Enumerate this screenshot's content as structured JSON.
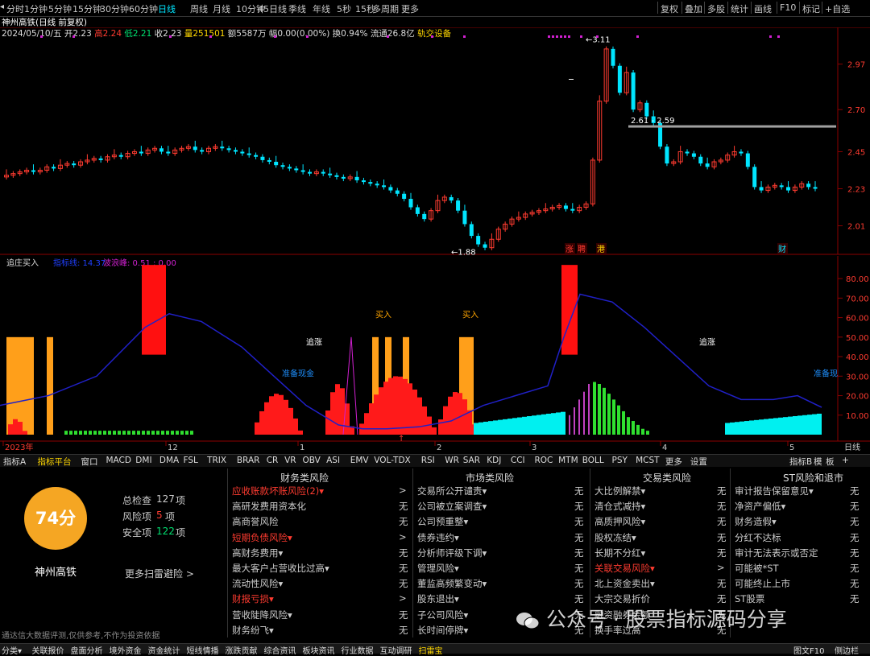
{
  "periods": [
    "分时",
    "1分钟",
    "5分钟",
    "15分钟",
    "30分钟",
    "60分钟",
    "日线",
    "周线",
    "月线",
    "10分钟",
    "45日线",
    "季线",
    "年线",
    "5秒",
    "15秒",
    "多周期",
    "更多"
  ],
  "active_period": "日线",
  "right_tools": [
    "复权",
    "叠加",
    "多股",
    "统计",
    "画线",
    "F10",
    "标记",
    "+自选"
  ],
  "stock_title": "神州高铁(日线 前复权)",
  "info": {
    "date": "2024/05/10/五",
    "open_label": "开",
    "open": "2.23",
    "high_label": "高",
    "high": "2.24",
    "low_label": "低",
    "low": "2.21",
    "close_label": "收",
    "close": "2.23",
    "vol_label": "量",
    "vol": "251501",
    "amount_label": "额",
    "amount": "5587万",
    "change_label": "幅",
    "change": "0.00(0.00%)",
    "turnover_label": "换",
    "turnover": "0.94%",
    "float_label": "流通",
    "float": "26.8亿",
    "sector": "轨交设备"
  },
  "price_axis": [
    "2.97",
    "2.70",
    "2.45",
    "2.23",
    "2.01"
  ],
  "annotations": {
    "high_price": "3.11",
    "low_price": "1.88",
    "resistance": "2.61 - 2.59"
  },
  "event_tags": [
    "涨",
    "聘",
    "港",
    "财"
  ],
  "indicator": {
    "name": "追庄买入",
    "line1_label": "指标线",
    "line1_value": "14.37",
    "line2_label": "波浪峰",
    "line2_value": "0.51",
    "line3_value": "0.00",
    "axis": [
      "80.00",
      "70.00",
      "60.00",
      "50.00",
      "40.00",
      "30.00",
      "20.00",
      "10.00"
    ],
    "labels": {
      "chase": "追涨",
      "buy": "买入",
      "prepare": "准备现金",
      "prepare_short": "准备现",
      "mid_buy": "买入"
    }
  },
  "time_axis": [
    "2023年",
    "12",
    "1",
    "2",
    "3",
    "4",
    "5"
  ],
  "time_axis_right": "日线",
  "indicator_tabs": [
    "指标A",
    "指标平台",
    "窗口",
    "MACD",
    "DMI",
    "DMA",
    "FSL",
    "TRIX",
    "BRAR",
    "CR",
    "VR",
    "OBV",
    "ASI",
    "EMV",
    "VOL-TDX",
    "RSI",
    "WR",
    "SAR",
    "KDJ",
    "CCI",
    "ROC",
    "MTM",
    "BOLL",
    "PSY",
    "MCST",
    "更多",
    "设置"
  ],
  "indicator_tabs_right": [
    "指标B",
    "模",
    "板",
    "+"
  ],
  "risk": {
    "score": "74分",
    "stock_name": "神州高铁",
    "total_label": "总检查",
    "total": "127",
    "total_unit": "项",
    "risk_label": "风险项",
    "risk_count": "5",
    "risk_unit": "项",
    "safe_label": "安全项",
    "safe": "122",
    "safe_unit": "项",
    "more": "更多扫雷避险 >",
    "disclaimer": "通达信大数据评测,仅供参考,不作为投资依据",
    "columns": [
      {
        "title": "财务类风险",
        "items": [
          {
            "name": "应收账款坏账风险(2)▾",
            "val": ">",
            "red": true
          },
          {
            "name": "高研发费用资本化",
            "val": "无",
            "red": false
          },
          {
            "name": "高商誉风险",
            "val": "无",
            "red": false
          },
          {
            "name": "短期负债风险▾",
            "val": ">",
            "red": true
          },
          {
            "name": "高财务费用▾",
            "val": "无",
            "red": false
          },
          {
            "name": "最大客户占营收比过高▾",
            "val": "无",
            "red": false
          },
          {
            "name": "流动性风险▾",
            "val": "无",
            "red": false
          },
          {
            "name": "财报亏损▾",
            "val": ">",
            "red": true
          },
          {
            "name": "营收陡降风险▾",
            "val": "无",
            "red": false
          },
          {
            "name": "财务纷飞▾",
            "val": "无",
            "red": false
          }
        ]
      },
      {
        "title": "市场类风险",
        "items": [
          {
            "name": "交易所公开谴责▾",
            "val": "无",
            "red": false
          },
          {
            "name": "公司被立案调查▾",
            "val": "无",
            "red": false
          },
          {
            "name": "公司预重整▾",
            "val": "无",
            "red": false
          },
          {
            "name": "债券违约▾",
            "val": "无",
            "red": false
          },
          {
            "name": "分析师评级下调▾",
            "val": "无",
            "red": false
          },
          {
            "name": "管理风险▾",
            "val": "无",
            "red": false
          },
          {
            "name": "董监高频繁变动▾",
            "val": "无",
            "red": false
          },
          {
            "name": "股东退出▾",
            "val": "无",
            "red": false
          },
          {
            "name": "子公司风险▾",
            "val": "无",
            "red": false
          },
          {
            "name": "长时间停牌▾",
            "val": "无",
            "red": false
          }
        ]
      },
      {
        "title": "交易类风险",
        "items": [
          {
            "name": "大比例解禁▾",
            "val": "无",
            "red": false
          },
          {
            "name": "清仓式减持▾",
            "val": "无",
            "red": false
          },
          {
            "name": "高质押风险▾",
            "val": "无",
            "red": false
          },
          {
            "name": "股权冻结▾",
            "val": "无",
            "red": false
          },
          {
            "name": "长期不分红▾",
            "val": "无",
            "red": false
          },
          {
            "name": "关联交易风险▾",
            "val": ">",
            "red": true
          },
          {
            "name": "北上资金卖出▾",
            "val": "无",
            "red": false
          },
          {
            "name": "大宗交易折价",
            "val": "无",
            "red": false
          },
          {
            "name": "融资融券余额",
            "val": "无",
            "red": false
          },
          {
            "name": "换手率过高",
            "val": "无",
            "red": false
          }
        ]
      },
      {
        "title": "ST风险和退市",
        "items": [
          {
            "name": "审计报告保留意见▾",
            "val": "无",
            "red": false
          },
          {
            "name": "净资产偏低▾",
            "val": "无",
            "red": false
          },
          {
            "name": "财务造假▾",
            "val": "无",
            "red": false
          },
          {
            "name": "分红不达标",
            "val": "无",
            "red": false
          },
          {
            "name": "审计无法表示或否定",
            "val": "无",
            "red": false
          },
          {
            "name": "可能被*ST",
            "val": "无",
            "red": false
          },
          {
            "name": "可能终止上市",
            "val": "无",
            "red": false
          },
          {
            "name": "ST股票",
            "val": "无",
            "red": false
          },
          {
            "name": "",
            "val": "",
            "red": false
          },
          {
            "name": "",
            "val": "",
            "red": false
          }
        ]
      }
    ]
  },
  "watermark": "公众号 · 股票指标源码分享",
  "status_tabs": [
    "分类▾",
    "关联报价",
    "盘面分析",
    "境外资金",
    "资金统计",
    "短线情播",
    "涨跌贡献",
    "综合资讯",
    "板块资讯",
    "行业数据",
    "互动调研",
    "扫雷宝"
  ],
  "status_right": [
    "图文F10",
    "侧边栏"
  ],
  "colors": {
    "up": "#ff3b30",
    "down": "#00e5ff",
    "accent": "#f5a623",
    "indicator_line": "#2020c8"
  },
  "chart_data": {
    "type": "candlestick",
    "title": "神州高铁(日线 前复权)",
    "ylim": [
      1.85,
      3.15
    ],
    "price_ticks": [
      2.97,
      2.7,
      2.45,
      2.23,
      2.01
    ],
    "close_series": [
      2.31,
      2.32,
      2.33,
      2.34,
      2.33,
      2.34,
      2.36,
      2.35,
      2.37,
      2.38,
      2.37,
      2.39,
      2.4,
      2.41,
      2.4,
      2.42,
      2.43,
      2.42,
      2.44,
      2.45,
      2.44,
      2.46,
      2.47,
      2.45,
      2.44,
      2.46,
      2.47,
      2.48,
      2.46,
      2.45,
      2.47,
      2.48,
      2.47,
      2.46,
      2.45,
      2.44,
      2.43,
      2.42,
      2.4,
      2.39,
      2.37,
      2.36,
      2.35,
      2.34,
      2.33,
      2.32,
      2.33,
      2.32,
      2.31,
      2.3,
      2.29,
      2.3,
      2.28,
      2.27,
      2.26,
      2.25,
      2.24,
      2.22,
      2.2,
      2.17,
      2.12,
      2.08,
      2.05,
      2.1,
      2.16,
      2.18,
      2.16,
      2.1,
      2.02,
      1.95,
      1.9,
      1.88,
      1.93,
      1.99,
      2.02,
      2.05,
      2.06,
      2.08,
      2.09,
      2.1,
      2.11,
      2.12,
      2.13,
      2.11,
      2.1,
      2.12,
      2.14,
      2.4,
      2.75,
      3.06,
      2.96,
      2.8,
      2.92,
      2.7,
      2.74,
      2.66,
      2.62,
      2.48,
      2.38,
      2.39,
      2.45,
      2.44,
      2.42,
      2.38,
      2.36,
      2.39,
      2.4,
      2.43,
      2.45,
      2.44,
      2.36,
      2.24,
      2.22,
      2.24,
      2.25,
      2.24,
      2.22,
      2.24,
      2.26,
      2.24,
      2.23
    ]
  }
}
